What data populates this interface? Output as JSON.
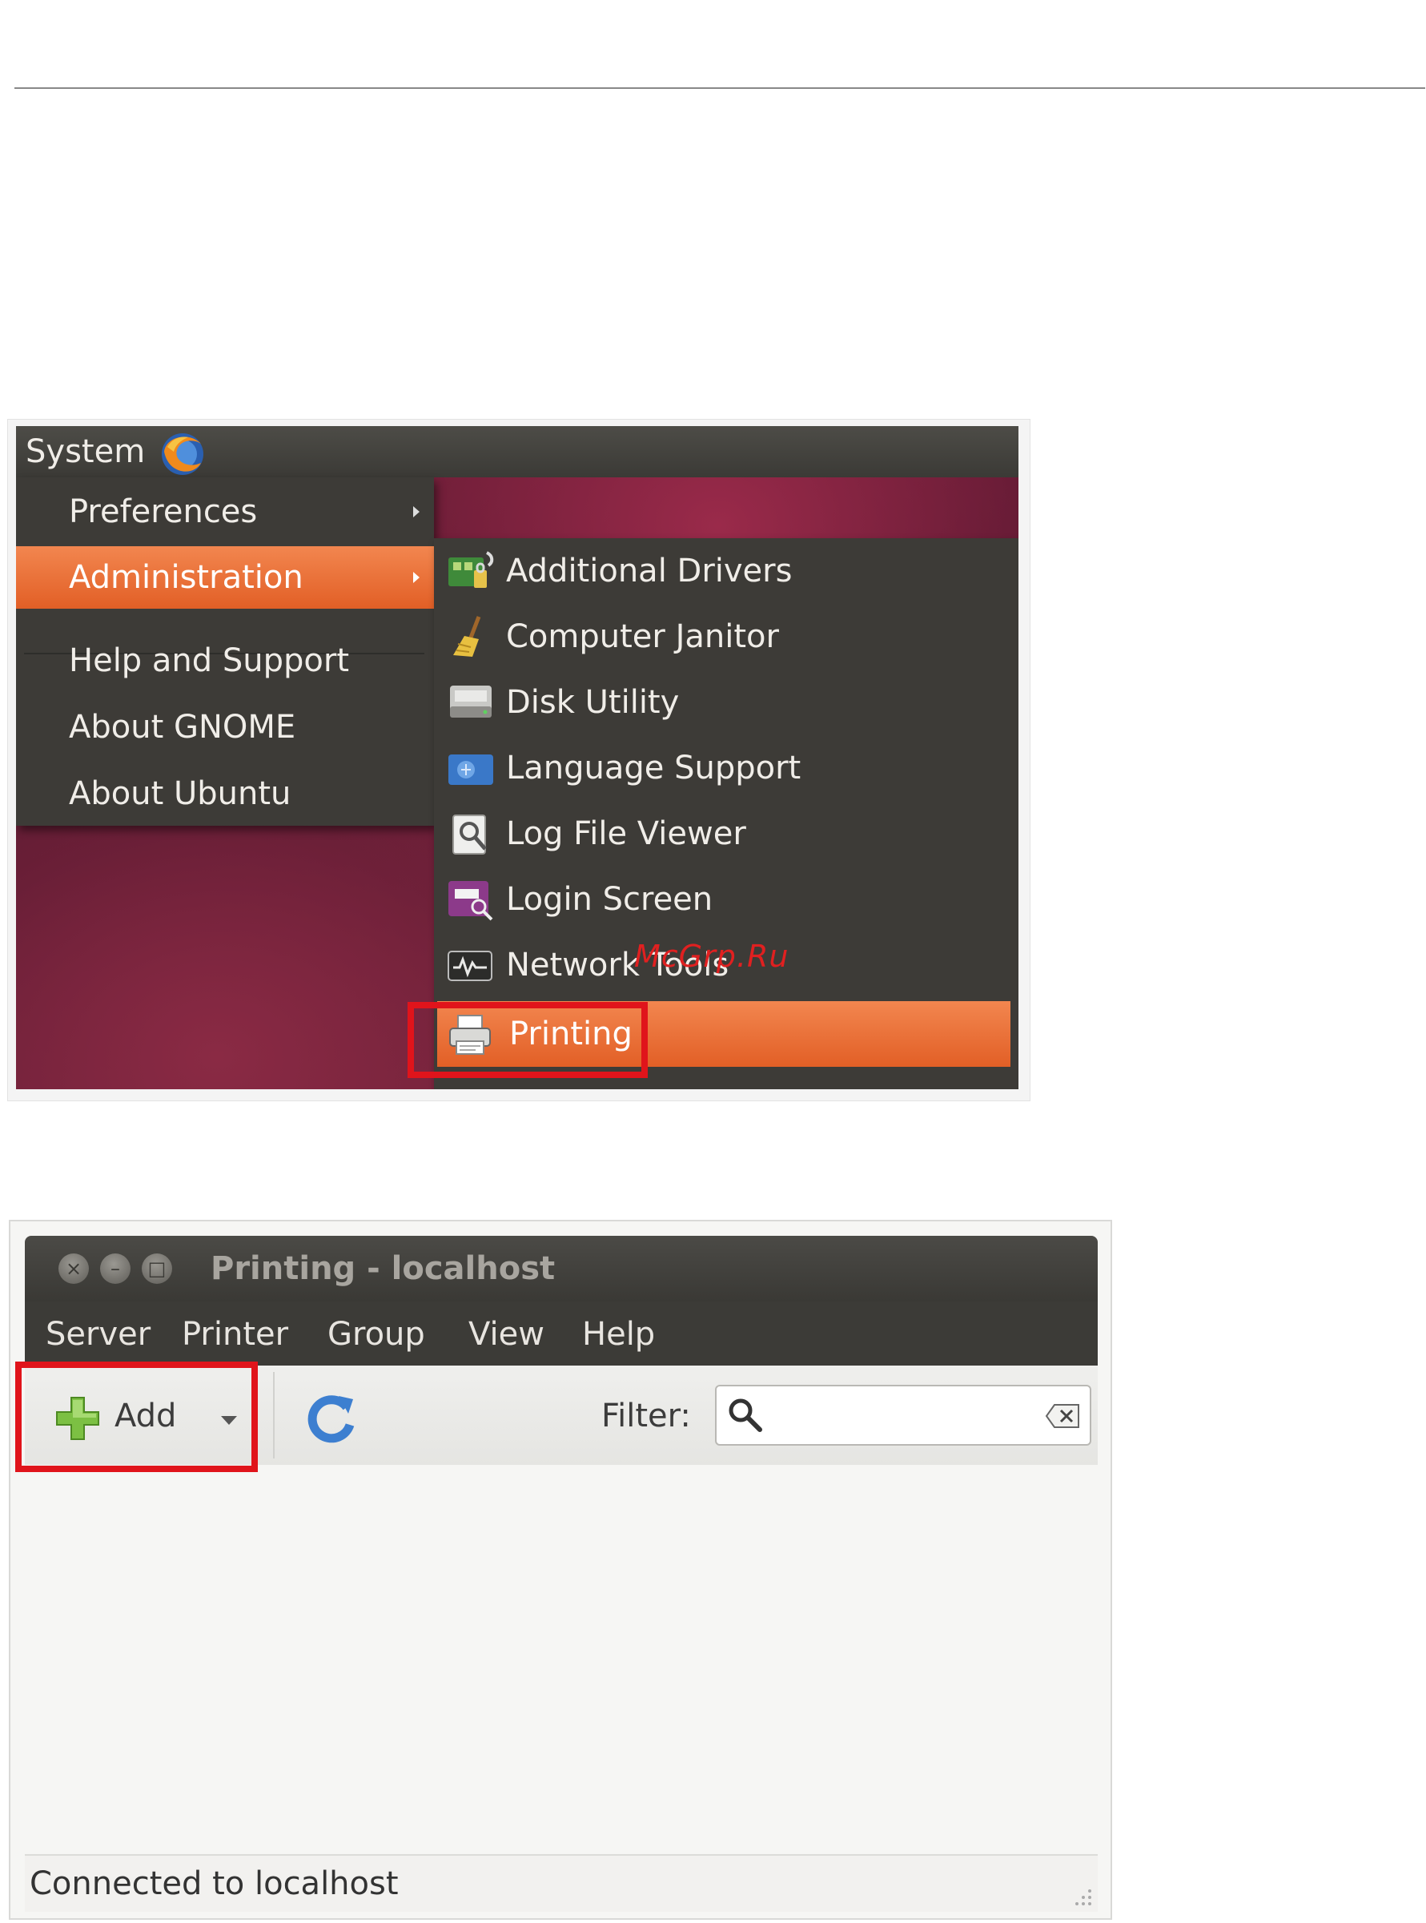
{
  "menu_screenshot": {
    "panel": {
      "system_label": "System"
    },
    "system_menu": {
      "items": [
        {
          "label": "Preferences",
          "has_submenu": true
        },
        {
          "label": "Administration",
          "has_submenu": true,
          "active": true
        },
        {
          "label": "Help and Support"
        },
        {
          "label": "About GNOME"
        },
        {
          "label": "About Ubuntu"
        }
      ]
    },
    "administration_submenu": {
      "items": [
        {
          "label": "Additional Drivers",
          "icon": "additional-drivers-icon"
        },
        {
          "label": "Computer Janitor",
          "icon": "broom-icon"
        },
        {
          "label": "Disk Utility",
          "icon": "disk-drive-icon"
        },
        {
          "label": "Language Support",
          "icon": "language-flag-icon"
        },
        {
          "label": "Log File Viewer",
          "icon": "log-viewer-icon"
        },
        {
          "label": "Login Screen",
          "icon": "login-screen-icon"
        },
        {
          "label": "Network Tools",
          "icon": "network-tools-icon"
        },
        {
          "label": "Printing",
          "icon": "printer-icon",
          "active": true
        }
      ]
    },
    "watermark": "McGrp.Ru"
  },
  "printing_window": {
    "title": "Printing - localhost",
    "menubar": [
      "Server",
      "Printer",
      "Group",
      "View",
      "Help"
    ],
    "toolbar": {
      "add_label": "Add",
      "filter_label": "Filter:",
      "filter_value": ""
    },
    "status": "Connected to localhost"
  },
  "colors": {
    "highlight_box": "#e0141b",
    "menu_active": "#e9672f",
    "menu_bg": "#3d3b37",
    "panel_bg": "#3c3b37"
  }
}
